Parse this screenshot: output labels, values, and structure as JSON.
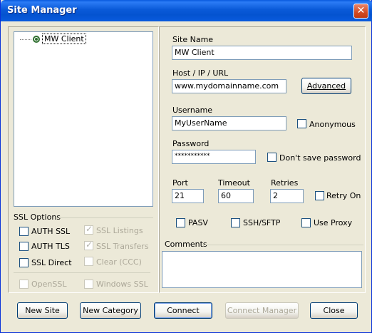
{
  "window": {
    "title": "Site Manager",
    "close_glyph": "✕"
  },
  "tree": {
    "items": [
      {
        "label": "MW Client",
        "icon": "site-node-icon"
      }
    ]
  },
  "ssl": {
    "group_label": "SSL Options",
    "auth_ssl": "AUTH SSL",
    "auth_tls": "AUTH TLS",
    "ssl_direct": "SSL Direct",
    "ssl_listings": "SSL Listings",
    "ssl_transfers": "SSL Transfers",
    "clear_ccc": "Clear (CCC)",
    "openssl": "OpenSSL",
    "windows_ssl": "Windows SSL"
  },
  "form": {
    "site_name_label": "Site Name",
    "site_name_value": "MW Client",
    "host_label": "Host / IP / URL",
    "host_value": "www.mydomainname.com",
    "advanced_button": "Advanced",
    "username_label": "Username",
    "username_value": "MyUserName",
    "anonymous_label": "Anonymous",
    "password_label": "Password",
    "password_value": "***********",
    "dont_save_label": "Don't save password",
    "port_label": "Port",
    "port_value": "21",
    "timeout_label": "Timeout",
    "timeout_value": "60",
    "retries_label": "Retries",
    "retries_value": "2",
    "retry_on_label": "Retry On",
    "pasv_label": "PASV",
    "ssh_sftp_label": "SSH/SFTP",
    "use_proxy_label": "Use Proxy",
    "comments_label": "Comments",
    "comments_value": ""
  },
  "buttons": {
    "new_site": "New Site",
    "new_category": "New Category",
    "connect": "Connect",
    "connect_manager": "Connect Manager",
    "close": "Close"
  },
  "colors": {
    "titlebar": "#0a5bde",
    "face": "#ece9d8",
    "field_border": "#7f9db9",
    "disabled_text": "#aca899"
  }
}
